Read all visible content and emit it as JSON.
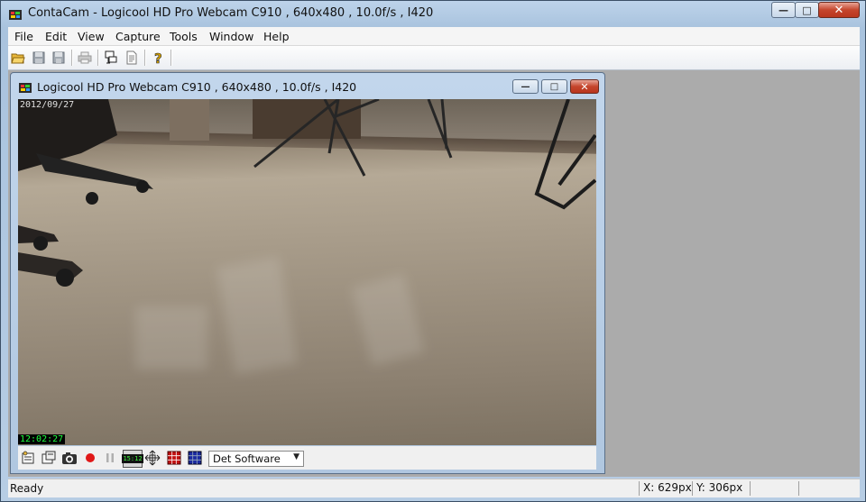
{
  "app": {
    "title": "ContaCam - Logicool HD Pro Webcam C910 , 640x480 , 10.0f/s , I420"
  },
  "menu": {
    "items": [
      "File",
      "Edit",
      "View",
      "Capture",
      "Tools",
      "Window",
      "Help"
    ]
  },
  "toolbar": {
    "icons": [
      "open-folder-icon",
      "save-icon",
      "save-as-icon",
      "print-icon",
      "network-icon",
      "document-icon",
      "help-icon"
    ]
  },
  "child_window": {
    "title": "Logicool HD Pro Webcam C910 , 640x480 , 10.0f/s , I420"
  },
  "video": {
    "date_overlay": "2012/09/27",
    "time_overlay": "12:02:27"
  },
  "controls": {
    "time_badge": "15:12",
    "detection_select": "Det Software",
    "colors": {
      "record": "#e01818",
      "grid_red": "#c01010",
      "grid_blue": "#1a2aa0"
    }
  },
  "status": {
    "text": "Ready",
    "x": "X: 629px",
    "y": "Y: 306px"
  }
}
